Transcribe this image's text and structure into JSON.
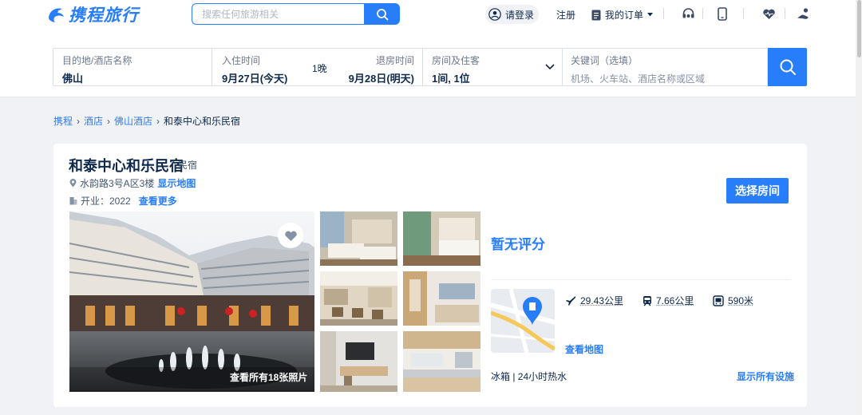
{
  "header": {
    "brand": "携程旅行",
    "search_placeholder": "搜索任何旅游相关",
    "login": "请登录",
    "register": "注册",
    "orders": "我的订单"
  },
  "booking_form": {
    "destination_label": "目的地/酒店名称",
    "destination_value": "佛山",
    "checkin_label": "入住时间",
    "checkin_value": "9月27日(今天)",
    "nights": "1晚",
    "checkout_label": "退房时间",
    "checkout_value": "9月28日(明天)",
    "rooms_label": "房间及住客",
    "rooms_value": "1间, 1位",
    "keyword_label": "关键词（选填）",
    "keyword_placeholder": "机场、火车站、酒店名称或区域"
  },
  "breadcrumb": [
    "携程",
    "酒店",
    "佛山酒店",
    "和泰中心和乐民宿"
  ],
  "hotel": {
    "name": "和泰中心和乐民宿",
    "type": "民宿",
    "address": "水韵路3号A区3楼",
    "show_map": "显示地图",
    "opened_label": "开业：2022",
    "see_more": "查看更多",
    "select_room": "选择房间",
    "all_photos": "查看所有18张照片",
    "score": "暂无评分",
    "distances": [
      {
        "icon": "airplane-icon",
        "text": "29.43公里"
      },
      {
        "icon": "train-icon",
        "text": "7.66公里"
      },
      {
        "icon": "metro-icon",
        "text": "590米"
      }
    ],
    "view_map": "查看地图",
    "facilities": "冰箱 | 24小时热水",
    "show_facilities": "显示所有设施"
  },
  "colors": {
    "brand_blue": "#287dfa",
    "text_dark": "#0f294d",
    "page_bg": "#f0f2f5"
  }
}
